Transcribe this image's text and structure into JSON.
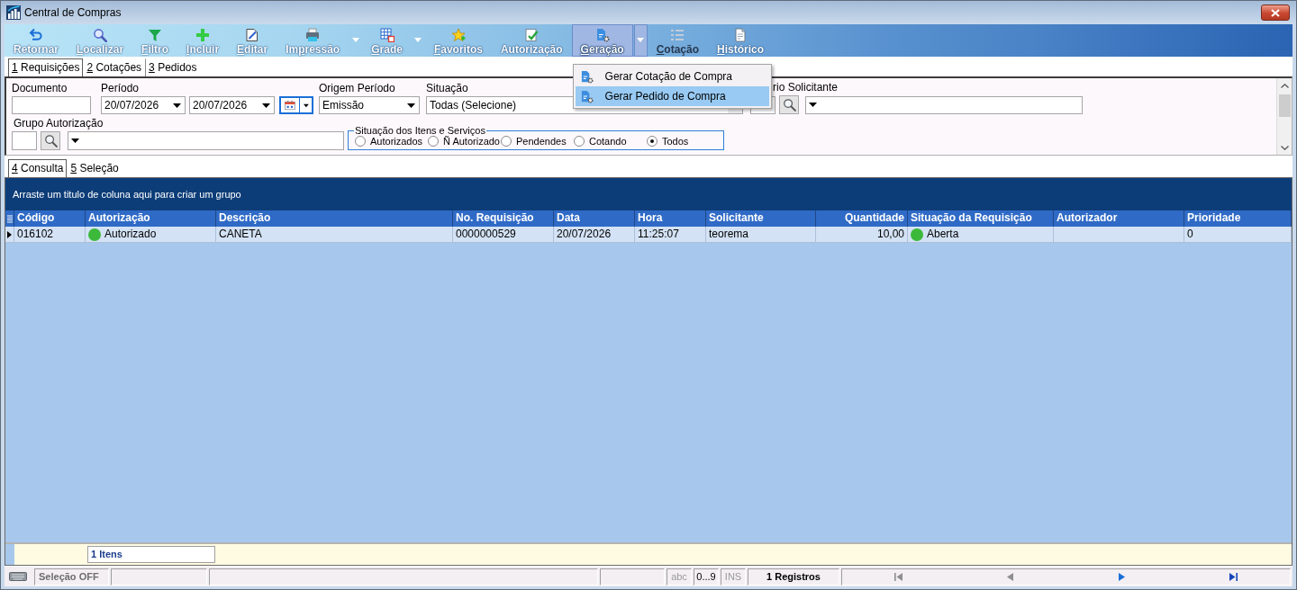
{
  "window": {
    "title": "Central de Compras"
  },
  "toolbar": [
    {
      "label": [
        {
          "text": "Retornar",
          "underlined": false
        }
      ],
      "dropdown": false,
      "pressed": false,
      "disabled": false
    },
    {
      "label": [
        {
          "text": "L",
          "underlined": true
        },
        {
          "text": "ocalizar",
          "underlined": false
        }
      ],
      "dropdown": false,
      "pressed": false,
      "disabled": false
    },
    {
      "label": [
        {
          "text": "F",
          "underlined": true
        },
        {
          "text": "iltro",
          "underlined": false
        }
      ],
      "dropdown": false,
      "pressed": false,
      "disabled": false
    },
    {
      "label": [
        {
          "text": "I",
          "underlined": true
        },
        {
          "text": "ncluir",
          "underlined": false
        }
      ],
      "dropdown": false,
      "pressed": false,
      "disabled": false
    },
    {
      "label": [
        {
          "text": "E",
          "underlined": true
        },
        {
          "text": "ditar",
          "underlined": false
        }
      ],
      "dropdown": false,
      "pressed": false,
      "disabled": false
    },
    {
      "label": [
        {
          "text": "Im",
          "underlined": false
        },
        {
          "text": "p",
          "underlined": true
        },
        {
          "text": "ressão",
          "underlined": false
        }
      ],
      "dropdown": true,
      "pressed": false,
      "disabled": false
    },
    {
      "label": [
        {
          "text": "G",
          "underlined": true
        },
        {
          "text": "rade",
          "underlined": false
        }
      ],
      "dropdown": true,
      "pressed": false,
      "disabled": false
    },
    {
      "label": [
        {
          "text": "F",
          "underlined": true
        },
        {
          "text": "avoritos",
          "underlined": false
        }
      ],
      "dropdown": false,
      "pressed": false,
      "disabled": false
    },
    {
      "label": [
        {
          "text": "Autorização",
          "underlined": false
        }
      ],
      "dropdown": false,
      "pressed": false,
      "disabled": false
    },
    {
      "label": [
        {
          "text": "G",
          "underlined": true
        },
        {
          "text": "eração",
          "underlined": false
        }
      ],
      "dropdown": true,
      "pressed": true,
      "disabled": false,
      "menu": [
        {
          "label": "Gerar Cotação de Compra",
          "selected": false
        },
        {
          "label": "Gerar Pedido de Compra",
          "selected": true
        }
      ]
    },
    {
      "label": [
        {
          "text": "C",
          "underlined": true
        },
        {
          "text": "otação",
          "underlined": false
        }
      ],
      "dropdown": false,
      "pressed": false,
      "disabled": true
    },
    {
      "label": [
        {
          "text": "H",
          "underlined": true
        },
        {
          "text": "istórico",
          "underlined": false
        }
      ],
      "dropdown": false,
      "pressed": false,
      "disabled": false
    }
  ],
  "tabs": [
    {
      "label": [
        {
          "text": "1",
          "underlined": true
        },
        {
          "text": " Requisições",
          "underlined": false
        }
      ],
      "selected": true
    },
    {
      "label": [
        {
          "text": "2",
          "underlined": true
        },
        {
          "text": " Cotações",
          "underlined": false
        }
      ],
      "selected": false
    },
    {
      "label": [
        {
          "text": "3",
          "underlined": true
        },
        {
          "text": " Pedidos",
          "underlined": false
        }
      ],
      "selected": false
    }
  ],
  "filters": {
    "document": {
      "label": "Documento"
    },
    "period": {
      "label": "Período",
      "start": "20/07/2026",
      "end": "20/07/2026",
      "calendar_focused": true
    },
    "period_origin": {
      "label": "Origem Período",
      "value": "Emissão"
    },
    "status": {
      "label": "Situação",
      "value": "Todas (Selecione)"
    },
    "requester": {
      "label": "rio Solicitante"
    },
    "authorization_group": {
      "label": "Grupo Autorização"
    },
    "item_status": {
      "title": "Situação dos Itens e Serviços",
      "options": [
        {
          "label": "Autorizados",
          "selected": false
        },
        {
          "label": "Ñ Autorizado",
          "selected": false
        },
        {
          "label": "Pendendes",
          "selected": false
        },
        {
          "label": "Cotando",
          "selected": false
        },
        {
          "label": "Todos",
          "selected": true
        }
      ]
    }
  },
  "view_tabs": [
    {
      "label": [
        {
          "text": "4",
          "underlined": true
        },
        {
          "text": " Consulta",
          "underlined": false
        }
      ],
      "selected": true
    },
    {
      "label": [
        {
          "text": "5",
          "underlined": true
        },
        {
          "text": " Seleção",
          "underlined": false
        }
      ],
      "selected": false
    }
  ],
  "grid": {
    "group_hint": "Arraste um titulo de coluna aqui para criar um grupo",
    "columns": [
      {
        "label": "Código",
        "kind": "text"
      },
      {
        "label": "Autorização",
        "kind": "status"
      },
      {
        "label": "Descrição",
        "kind": "text"
      },
      {
        "label": "No. Requisição",
        "kind": "text"
      },
      {
        "label": "Data",
        "kind": "text"
      },
      {
        "label": "Hora",
        "kind": "text"
      },
      {
        "label": "Solicitante",
        "kind": "text"
      },
      {
        "label": "Quantidade",
        "kind": "number"
      },
      {
        "label": "Situação da Requisição",
        "kind": "status"
      },
      {
        "label": "Autorizador",
        "kind": "text"
      },
      {
        "label": "Prioridade",
        "kind": "text"
      }
    ],
    "rows": [
      {
        "current": true,
        "cells": [
          {
            "text": "016102"
          },
          {
            "text": "Autorizado",
            "color": "#3cb93a"
          },
          {
            "text": "CANETA"
          },
          {
            "text": "0000000529"
          },
          {
            "text": "20/07/2026"
          },
          {
            "text": "11:25:07"
          },
          {
            "text": "teorema"
          },
          {
            "text": "10,00"
          },
          {
            "text": "Aberta",
            "color": "#3cb93a"
          },
          null,
          {
            "text": "0"
          }
        ]
      }
    ],
    "summary": "1 Itens"
  },
  "status_bar": {
    "selection": "Seleção OFF",
    "indicators": [
      {
        "label": "abc",
        "on": false
      },
      {
        "label": "0...9",
        "on": true
      },
      {
        "label": "INS",
        "on": false
      }
    ],
    "records": "1 Registros",
    "navigation": [
      {
        "disabled": true
      },
      {
        "disabled": true
      },
      {
        "disabled": false
      },
      {
        "disabled": false
      }
    ]
  }
}
